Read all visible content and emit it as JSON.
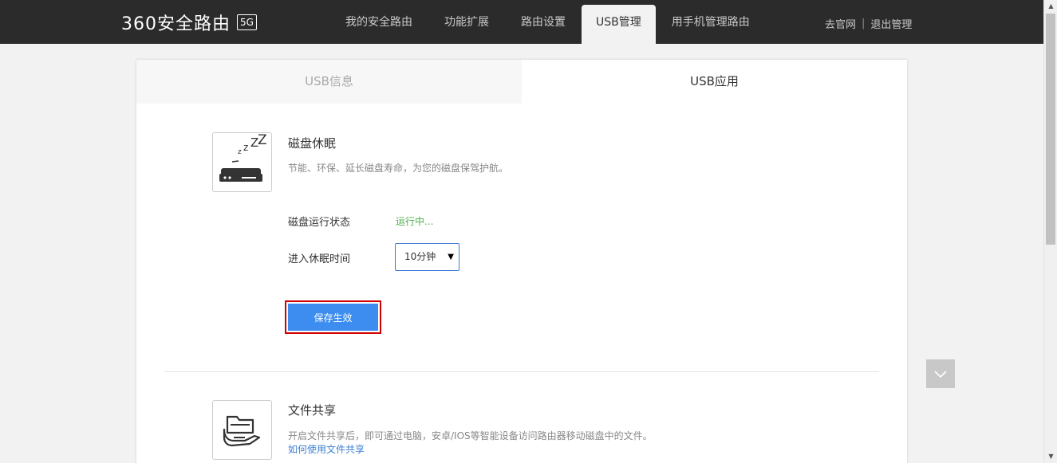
{
  "header": {
    "logo_text": "360安全路由",
    "logo_badge": "5G",
    "nav": [
      {
        "label": "我的安全路由"
      },
      {
        "label": "功能扩展"
      },
      {
        "label": "路由设置"
      },
      {
        "label": "USB管理"
      },
      {
        "label": "用手机管理路由"
      }
    ],
    "active_nav": "USB管理",
    "links": {
      "official_site": "去官网",
      "separator": "|",
      "logout": "退出管理"
    }
  },
  "tabs": [
    {
      "label": "USB信息"
    },
    {
      "label": "USB应用"
    }
  ],
  "active_tab": "USB应用",
  "disk_sleep": {
    "title": "磁盘休眠",
    "description": "节能、环保、延长磁盘寿命，为您的磁盘保驾护航。",
    "status_label": "磁盘运行状态",
    "status_value": "运行中...",
    "sleep_time_label": "进入休眠时间",
    "sleep_time_value": "10分钟",
    "save_label": "保存生效"
  },
  "file_share": {
    "title": "文件共享",
    "description": "开启文件共享后，即可通过电脑，安卓/IOS等智能设备访问路由器移动磁盘中的文件。",
    "help_link": "如何使用文件共享"
  },
  "colors": {
    "topbar": "#2b2b2b",
    "accent_button": "#3d8df0",
    "status_green": "#4cae4c",
    "highlight_red": "#d00000",
    "link_blue": "#3d7fd6"
  }
}
